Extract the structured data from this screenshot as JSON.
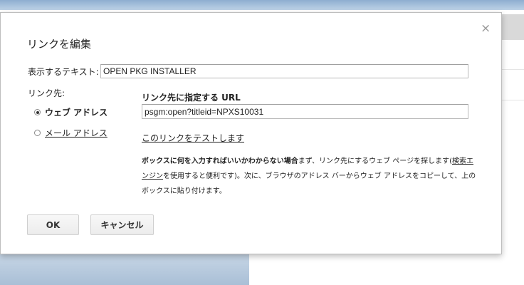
{
  "dialog": {
    "title": "リンクを編集",
    "close_glyph": "×",
    "display_text_label": "表示するテキスト:",
    "display_text_value": "OPEN PKG INSTALLER",
    "link_to_label": "リンク先:",
    "options": {
      "web": "ウェブ アドレス",
      "mail": "メール アドレス",
      "selected": "web"
    },
    "url_heading": "リンク先に指定する URL",
    "url_value": "psgm:open?titleid=NPXS10031",
    "test_link": "このリンクをテストします",
    "help": {
      "bold": "ボックスに何を入力すればいいかわからない場合",
      "text1": "まず、リンク先にするウェブ ページを探します",
      "paren_open": "(",
      "search_link": "検索エンジン",
      "text2": "を使用すると便利です)。次に、ブラウザのアドレス バーからウェブ アドレスをコピーして、上のボックスに貼り付けます。"
    },
    "buttons": {
      "ok": "OK",
      "cancel": "キャンセル"
    }
  }
}
